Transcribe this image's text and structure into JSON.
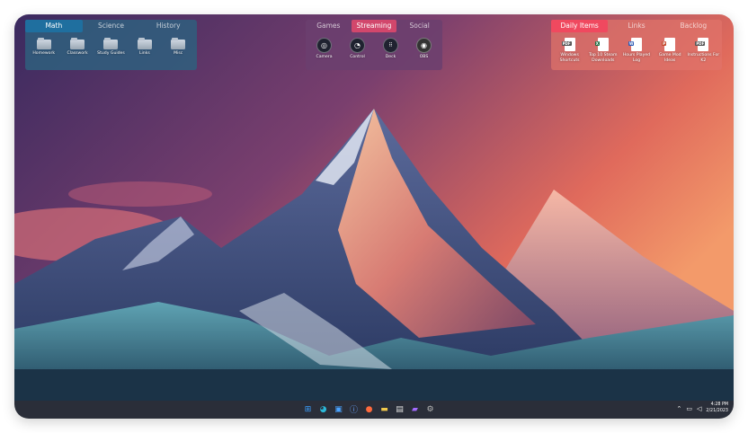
{
  "fences": [
    {
      "tabs": [
        "Math",
        "Science",
        "History"
      ],
      "active_tab": 0,
      "items": [
        {
          "label": "Homework",
          "icon": "folder-icon"
        },
        {
          "label": "Classwork",
          "icon": "folder-icon"
        },
        {
          "label": "Study Guides",
          "icon": "folder-icon"
        },
        {
          "label": "Links",
          "icon": "folder-icon"
        },
        {
          "label": "Misc",
          "icon": "folder-icon"
        }
      ]
    },
    {
      "tabs": [
        "Games",
        "Streaming",
        "Social"
      ],
      "active_tab": 1,
      "items": [
        {
          "label": "Camera",
          "icon": "camera-icon"
        },
        {
          "label": "Control",
          "icon": "control-icon"
        },
        {
          "label": "Deck",
          "icon": "deck-icon"
        },
        {
          "label": "OBS",
          "icon": "obs-icon"
        }
      ]
    },
    {
      "tabs": [
        "Daily Items",
        "Links",
        "Backlog"
      ],
      "active_tab": 0,
      "items": [
        {
          "label": "Windows Shortcuts",
          "icon": "pdf-file-icon"
        },
        {
          "label": "Top 10 Steam Downloads",
          "icon": "excel-file-icon"
        },
        {
          "label": "Hours Played Log",
          "icon": "word-file-icon"
        },
        {
          "label": "Game Mod Ideas",
          "icon": "powerpoint-file-icon"
        },
        {
          "label": "Instructions For K2",
          "icon": "pdf-file-icon"
        }
      ]
    }
  ],
  "taskbar": {
    "icons": [
      "windows-start-icon",
      "edge-icon",
      "store-icon",
      "1password-icon",
      "app-icon",
      "file-explorer-icon",
      "notepad-icon",
      "video-icon",
      "settings-icon"
    ],
    "time": "4:28 PM",
    "date": "2/21/2023"
  },
  "colors": {
    "fence1_bg": "#2f5f7e",
    "fence1_tab": "#1f6f9f",
    "fence2_bg": "#6b3f6e",
    "fence2_tab": "#d2476c",
    "fence3_bg": "#e0736a",
    "fence3_tab": "#f0495f"
  }
}
